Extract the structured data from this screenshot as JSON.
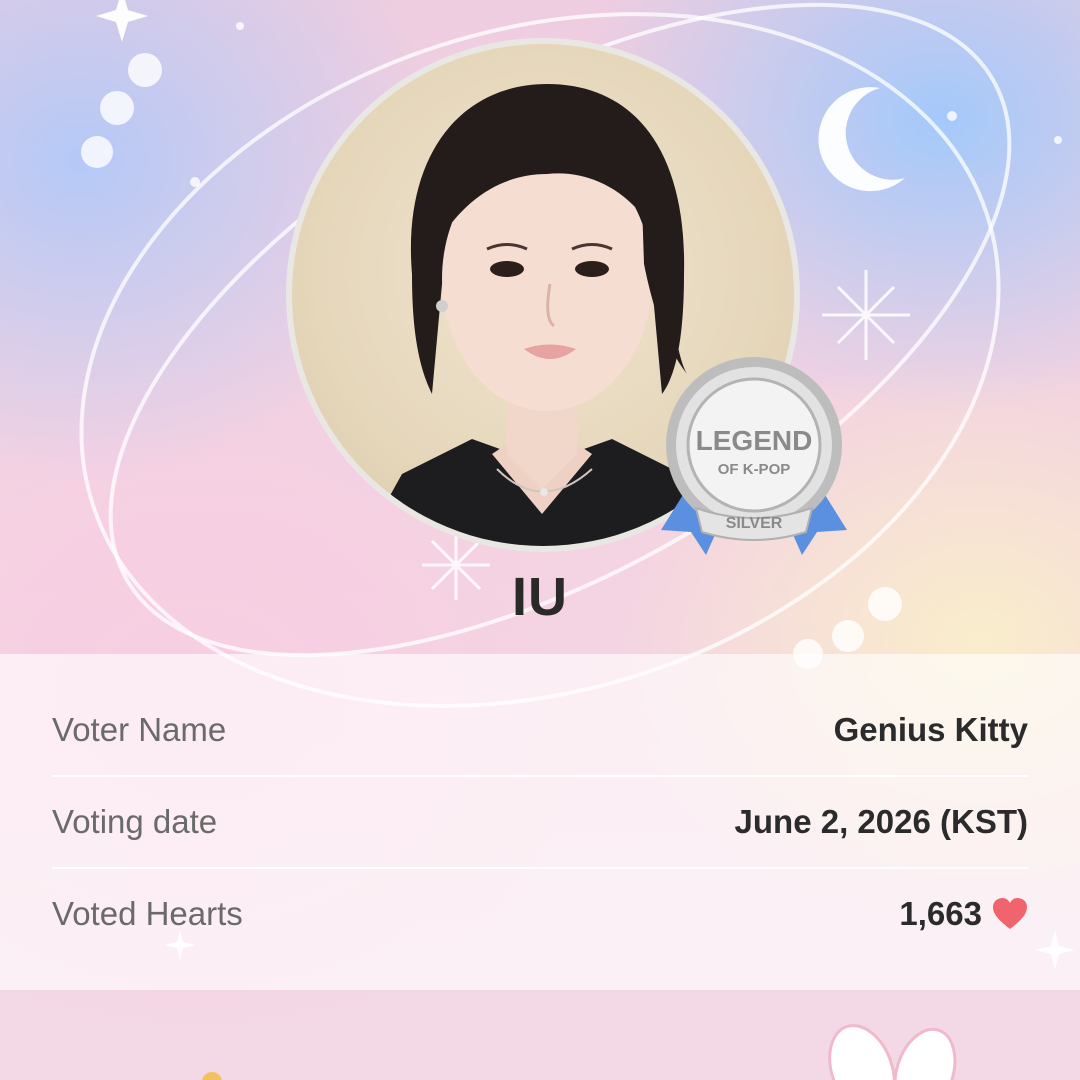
{
  "artist": {
    "name": "IU"
  },
  "badge": {
    "line1": "LEGEND",
    "line2": "OF K-POP",
    "tier": "SILVER"
  },
  "info": {
    "rows": [
      {
        "label": "Voter Name",
        "value": "Genius Kitty"
      },
      {
        "label": "Voting date",
        "value": "June 2, 2026 (KST)"
      },
      {
        "label": "Voted Hearts",
        "value": "1,663"
      }
    ]
  },
  "colors": {
    "heart": "#f0646e",
    "ribbon": "#5b8fe0",
    "badge_silver": "#c9c9c9"
  },
  "icons": {
    "moon": "crescent-moon-icon",
    "sparkle": "sparkle-icon",
    "heart": "heart-icon"
  }
}
